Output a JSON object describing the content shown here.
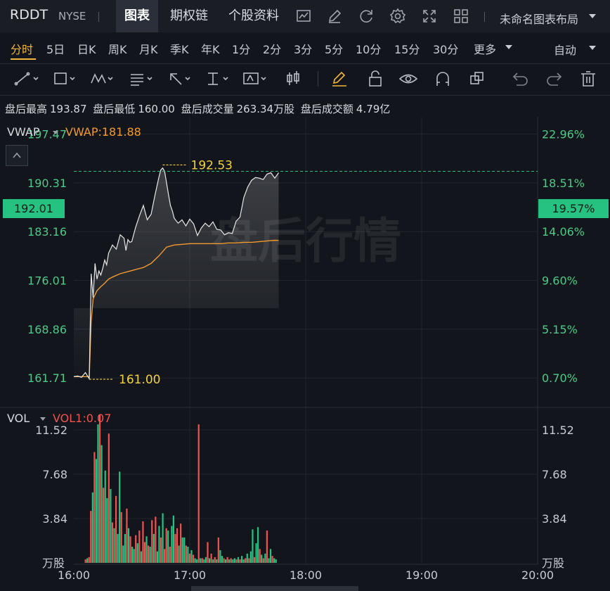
{
  "header": {
    "symbol": "RDDT",
    "exchange": "NYSE",
    "tabs": [
      {
        "label": "图表",
        "active": true
      },
      {
        "label": "期权链",
        "active": false
      },
      {
        "label": "个股资料",
        "active": false
      }
    ],
    "icons": [
      "indicator-icon",
      "draw-icon",
      "refresh-icon",
      "settings-icon",
      "fullscreen-icon",
      "layout-grid-icon"
    ],
    "layout_name": "未命名图表布局"
  },
  "periods": {
    "items": [
      "分时",
      "5日",
      "日K",
      "周K",
      "月K",
      "季K",
      "年K",
      "1分",
      "2分",
      "3分",
      "5分",
      "10分",
      "15分",
      "30分",
      "更多"
    ],
    "active": "分时",
    "scale_mode": "自动"
  },
  "toolbar": {
    "tools": [
      "trendline-tool",
      "rectangle-tool",
      "pattern-tool",
      "text-note-tool",
      "arrow-tool",
      "measure-tool",
      "text-tool",
      "candle-tool",
      "pen-tool",
      "lock-tool",
      "visibility-tool",
      "magnet-tool",
      "clone-tool",
      "undo-tool",
      "redo-tool",
      "delete-tool"
    ]
  },
  "info": {
    "items": [
      {
        "label": "盘后最高",
        "value": "193.87"
      },
      {
        "label": "盘后最低",
        "value": "160.00"
      },
      {
        "label": "盘后成交量",
        "value": "263.34万股"
      },
      {
        "label": "盘后成交额",
        "value": "4.79亿"
      }
    ]
  },
  "price_panel": {
    "indicator": "VWAP",
    "indicator_value": "VWAP:181.88",
    "current_price": "192.01",
    "current_pct": "19.57%",
    "high_marker": "192.53",
    "low_marker": "161.00",
    "watermark": "盘后行情"
  },
  "volume_panel": {
    "indicator": "VOL",
    "indicator_value": "VOL1:0.07",
    "unit_label": "万股"
  },
  "colors": {
    "up": "#ef5350",
    "down": "#26c281",
    "vwap": "#f29a2e",
    "accent": "#f3b63a"
  },
  "chart_data": {
    "type": "line",
    "price_axis": [
      "197.47",
      "190.31",
      "183.16",
      "176.01",
      "168.86",
      "161.71"
    ],
    "pct_axis": [
      "22.96%",
      "18.51%",
      "14.06%",
      "9.60%",
      "5.15%",
      "0.70%"
    ],
    "volume_axis": [
      "11.52",
      "7.68",
      "3.84"
    ],
    "time_axis": [
      "16:00",
      "17:00",
      "18:00",
      "19:00",
      "20:00"
    ],
    "ylim": [
      157.5,
      200
    ],
    "series": [
      {
        "name": "price",
        "t": [
          0,
          2,
          4,
          6,
          8,
          9,
          10,
          11,
          12,
          13,
          14,
          15,
          16,
          17,
          18,
          20,
          22,
          24,
          26,
          27,
          28,
          29,
          30,
          32,
          34,
          36,
          38,
          40,
          42,
          44,
          45,
          46,
          47,
          48,
          49,
          50,
          51,
          52,
          54,
          56,
          58,
          60,
          62,
          64,
          66,
          68,
          70,
          72,
          74,
          76,
          78,
          80,
          82,
          84,
          86,
          88,
          90,
          92,
          94,
          96,
          98,
          100,
          102,
          104,
          106
        ],
        "values": [
          161.9,
          162.0,
          161.8,
          162.5,
          161.6,
          177.0,
          173.5,
          178.5,
          176.2,
          177.4,
          176.8,
          177.8,
          179.0,
          178.3,
          180.0,
          181.2,
          180.6,
          182.7,
          182.2,
          180.4,
          182.0,
          181.6,
          181.7,
          183.8,
          185.5,
          187.0,
          184.9,
          185.7,
          188.5,
          191.1,
          192.2,
          192.5,
          192.0,
          190.3,
          188.6,
          187.0,
          186.2,
          185.1,
          184.4,
          184.9,
          184.0,
          185.0,
          184.3,
          182.6,
          183.7,
          184.4,
          183.9,
          184.6,
          183.5,
          183.4,
          182.7,
          183.0,
          182.9,
          184.7,
          185.3,
          188.2,
          189.7,
          190.7,
          191.1,
          191.0,
          190.8,
          191.6,
          191.8,
          191.0,
          191.8
        ]
      },
      {
        "name": "vwap",
        "t": [
          0,
          8,
          9,
          10,
          12,
          14,
          16,
          18,
          20,
          24,
          28,
          32,
          36,
          40,
          44,
          48,
          52,
          56,
          60,
          64,
          68,
          72,
          76,
          80,
          84,
          88,
          92,
          96,
          100,
          104,
          106
        ],
        "values": [
          161.9,
          161.9,
          170.0,
          173.3,
          174.5,
          175.1,
          175.6,
          176.2,
          176.5,
          177.0,
          177.3,
          177.6,
          177.9,
          178.5,
          179.6,
          180.9,
          181.2,
          181.3,
          181.4,
          181.4,
          181.4,
          181.4,
          181.4,
          181.5,
          181.5,
          181.6,
          181.6,
          181.7,
          181.8,
          181.9,
          181.88
        ]
      }
    ],
    "volume": {
      "max": 12.8,
      "values": [
        0.3,
        0.4,
        0.5,
        4.5,
        6.1,
        9.6,
        9.0,
        12.0,
        12.8,
        10.2,
        6.5,
        8.0,
        5.6,
        11.2,
        6.4,
        3.5,
        3.0,
        5.8,
        2.5,
        7.9,
        4.4,
        1.5,
        2.5,
        4.7,
        3.0,
        2.3,
        1.4,
        1.2,
        2.4,
        1.7,
        2.8,
        1.0,
        3.6,
        1.8,
        2.3,
        1.5,
        1.4,
        3.7,
        2.5,
        4.0,
        1.0,
        3.2,
        2.2,
        4.3,
        1.2,
        3.0,
        2.8,
        1.4,
        3.2,
        4.1,
        2.5,
        3.0,
        1.5,
        3.4,
        2.2,
        2.2,
        1.5,
        1.4,
        0.8,
        1.1,
        0.7,
        0.4,
        0.3,
        12.0,
        0.4,
        0.4,
        0.3,
        0.5,
        1.8,
        0.4,
        0.8,
        0.3,
        0.5,
        0.3,
        2.2,
        1.1,
        0.6,
        0.4,
        0.3,
        0.5,
        0.3,
        0.4,
        0.3,
        0.4,
        0.3,
        0.5,
        0.3,
        0.6,
        0.3,
        0.4,
        0.8,
        0.4,
        1.0,
        2.9,
        0.5,
        1.7,
        3.1,
        1.2,
        0.7,
        0.4,
        0.8,
        2.8,
        0.4,
        1.2,
        0.6,
        0.4,
        0.3
      ],
      "up": [
        1,
        0,
        1,
        1,
        0,
        1,
        0,
        0,
        1,
        0,
        1,
        0,
        0,
        1,
        0,
        1,
        0,
        1,
        0,
        0,
        1,
        0,
        0,
        1,
        0,
        1,
        0,
        0,
        1,
        0,
        1,
        0,
        1,
        1,
        0,
        1,
        0,
        1,
        0,
        1,
        0,
        0,
        1,
        0,
        1,
        1,
        0,
        1,
        0,
        0,
        1,
        1,
        0,
        1,
        0,
        0,
        1,
        0,
        1,
        0,
        1,
        0,
        0,
        1,
        0,
        1,
        0,
        0,
        1,
        0,
        1,
        0,
        1,
        0,
        1,
        0,
        0,
        1,
        0,
        1,
        0,
        1,
        0,
        0,
        1,
        0,
        1,
        0,
        0,
        1,
        0,
        1,
        0,
        0,
        1,
        0,
        0,
        1,
        0,
        1,
        0,
        1,
        0,
        0,
        1,
        0,
        0
      ]
    }
  }
}
